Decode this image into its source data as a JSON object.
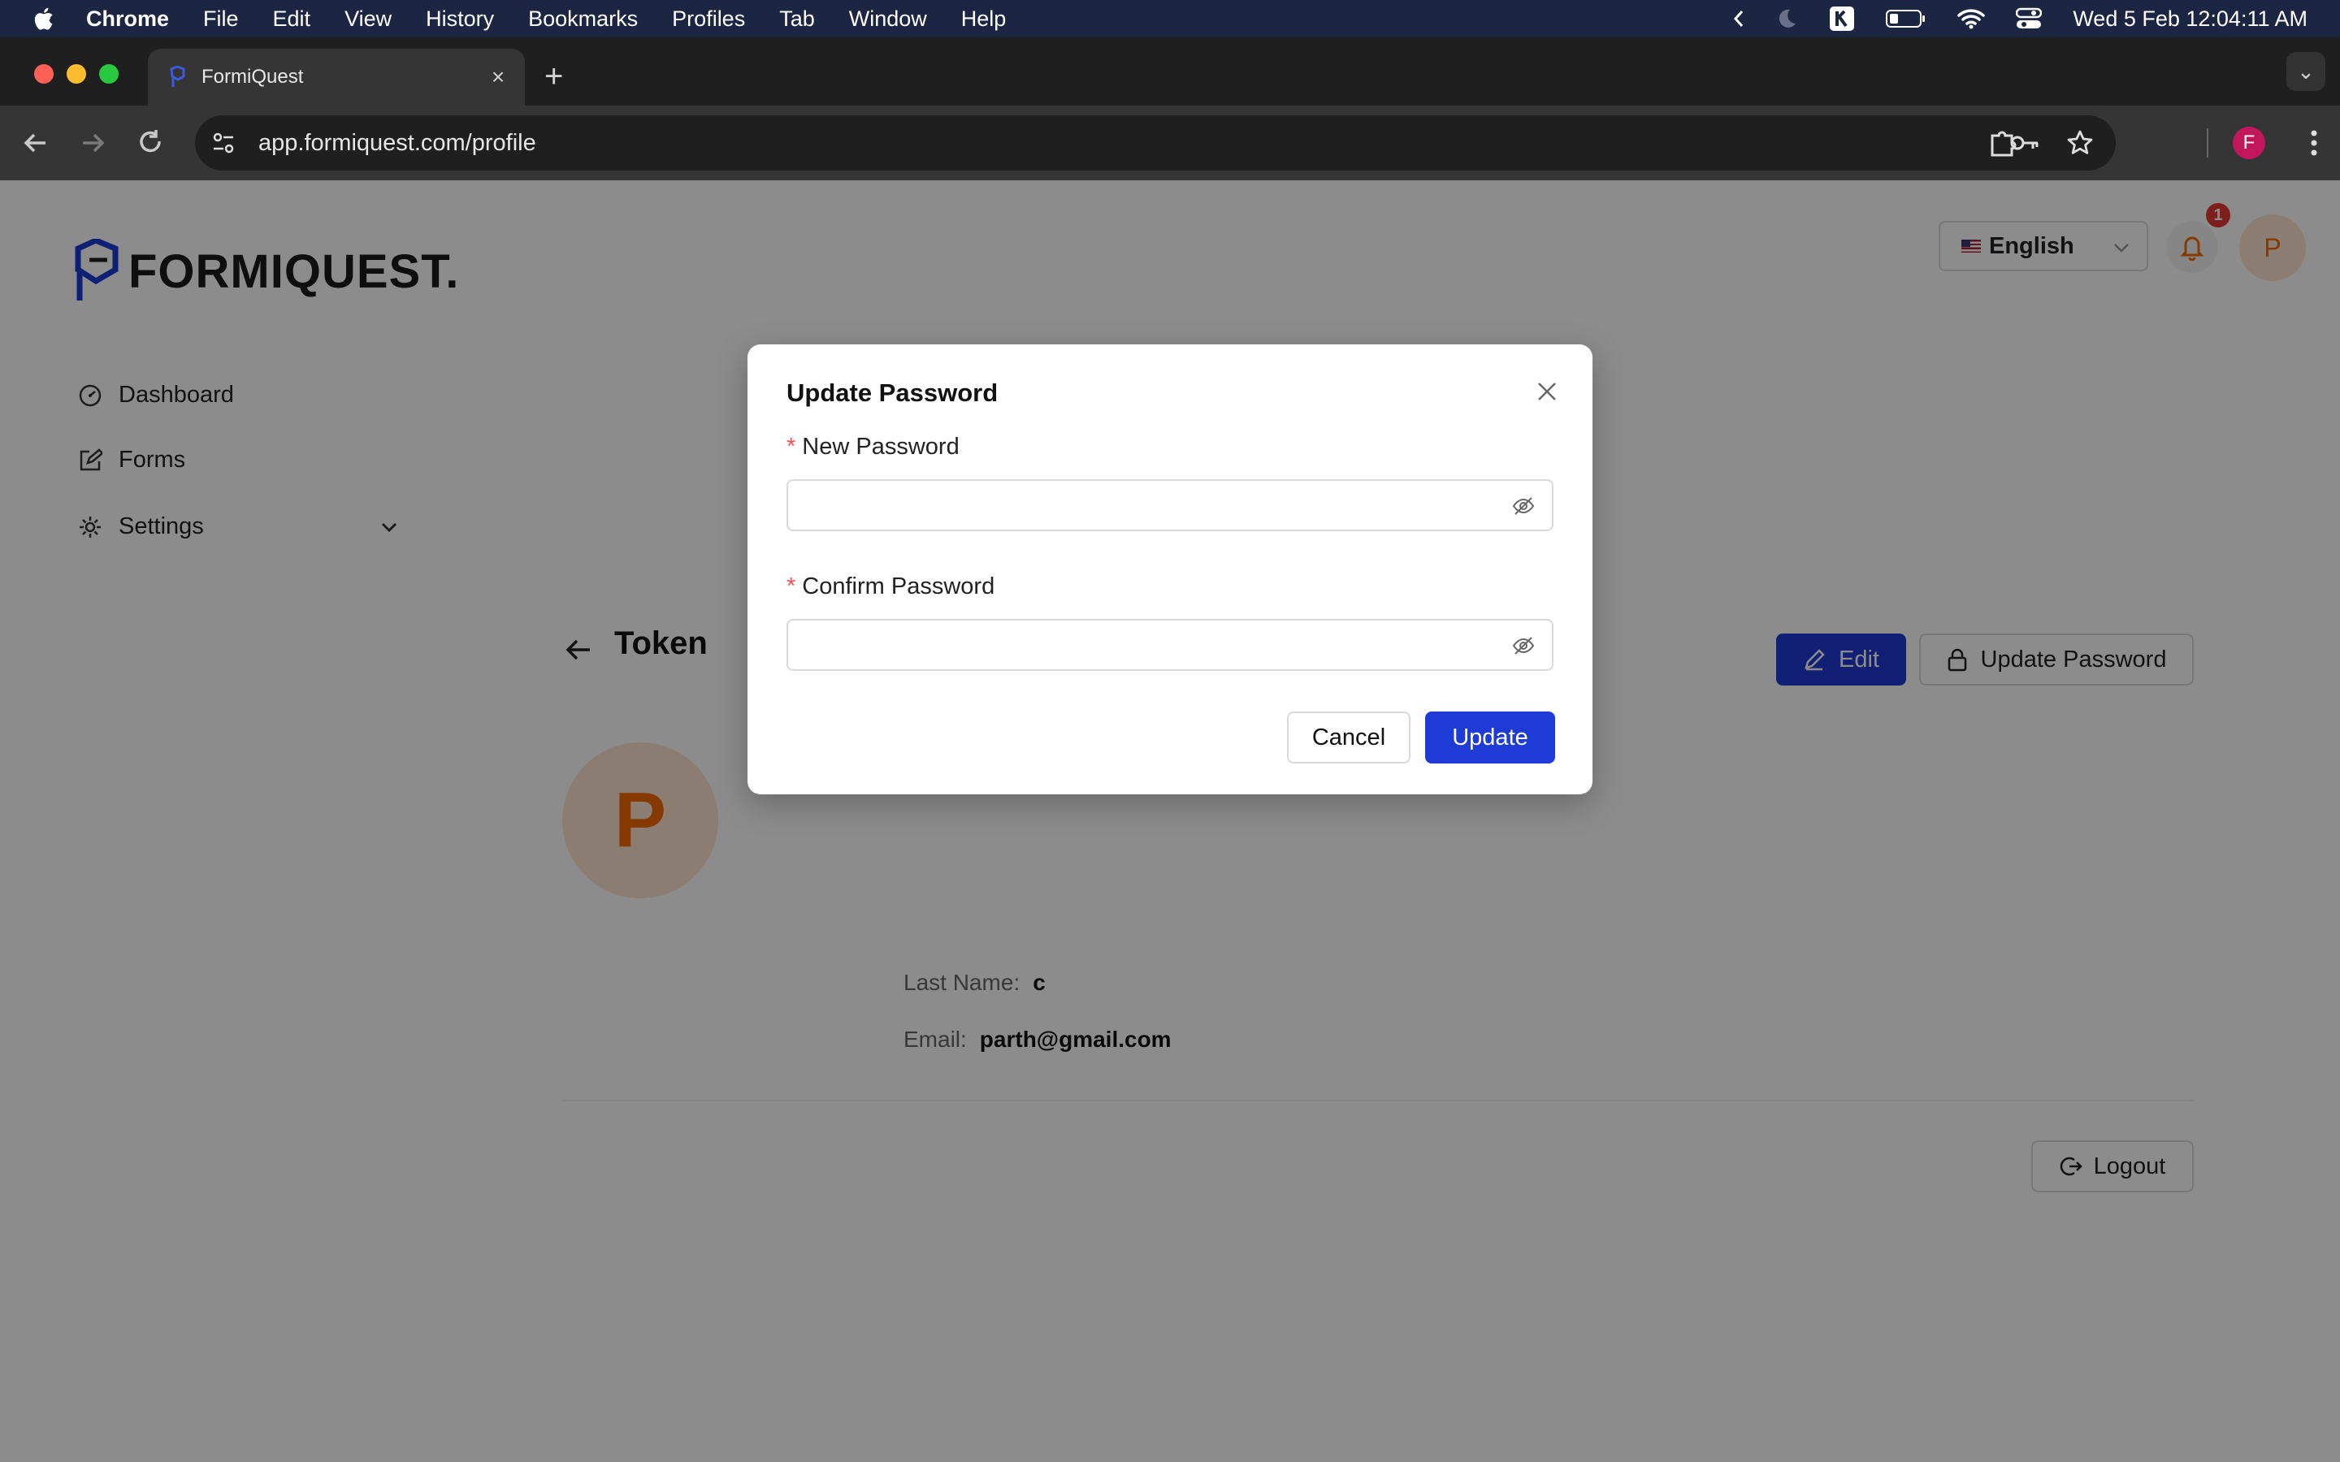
{
  "menubar": {
    "app_name": "Chrome",
    "items": [
      "File",
      "Edit",
      "View",
      "History",
      "Bookmarks",
      "Profiles",
      "Tab",
      "Window",
      "Help"
    ],
    "datetime": "Wed 5 Feb  12:04:11 AM"
  },
  "browser": {
    "tab_title": "FormiQuest",
    "url": "app.formiquest.com/profile",
    "profile_initial": "F"
  },
  "header": {
    "logo_text": "FORMIQUEST.",
    "language": "English",
    "notification_count": "1",
    "user_initial": "P"
  },
  "sidebar": {
    "items": [
      {
        "label": "Dashboard"
      },
      {
        "label": "Forms"
      },
      {
        "label": "Settings"
      }
    ]
  },
  "profile": {
    "title": "Token",
    "edit_label": "Edit",
    "update_password_label": "Update Password",
    "avatar_initial": "P",
    "last_name_label": "Last Name",
    "last_name_value": "c",
    "email_label": "Email",
    "email_value": "parth@gmail.com",
    "logout_label": "Logout"
  },
  "modal": {
    "title": "Update Password",
    "new_password_label": "New Password",
    "new_password_value": "",
    "confirm_password_label": "Confirm Password",
    "confirm_password_value": "",
    "required_mark": "*",
    "cancel_label": "Cancel",
    "update_label": "Update"
  },
  "colors": {
    "primary": "#1f3bd6",
    "avatar_bg": "#fde3cf",
    "avatar_text": "#f56a00",
    "required": "#ff4d4f",
    "badge": "#e53935"
  }
}
